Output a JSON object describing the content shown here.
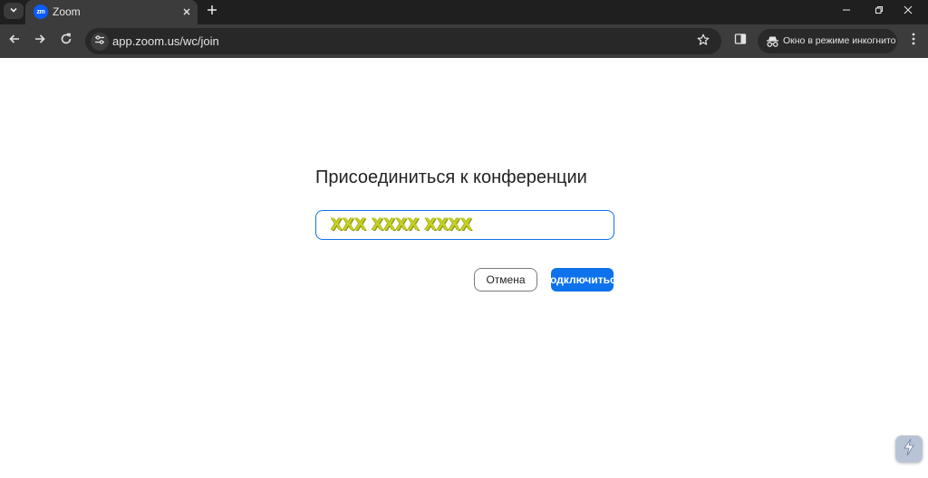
{
  "browser": {
    "tab": {
      "title": "Zoom",
      "favicon_text": "zm"
    },
    "address_bar": {
      "url": "app.zoom.us/wc/join"
    },
    "incognito_label": "Окно в режиме инкогнито"
  },
  "join": {
    "title": "Присоединиться к конференции",
    "meeting_id_value": "XXX XXXX XXXX",
    "cancel_label": "Отмена",
    "join_label": "Подключиться"
  },
  "icons": {
    "tab_search": "chevron-down-icon",
    "tab_close": "close-icon",
    "new_tab": "plus-icon",
    "back": "arrow-left-icon",
    "forward": "arrow-right-icon",
    "reload": "reload-icon",
    "site_info": "tune-icon",
    "bookmark": "star-icon",
    "side_panel": "side-panel-icon",
    "incognito": "incognito-icon",
    "menu": "kebab-menu-icon",
    "extension": "lightning-icon"
  },
  "colors": {
    "accent": "#0e72ed",
    "meeting_id_text": "#c5d11f",
    "chrome_dark": "#1f1f1f",
    "toolbar": "#3c3c3c"
  }
}
